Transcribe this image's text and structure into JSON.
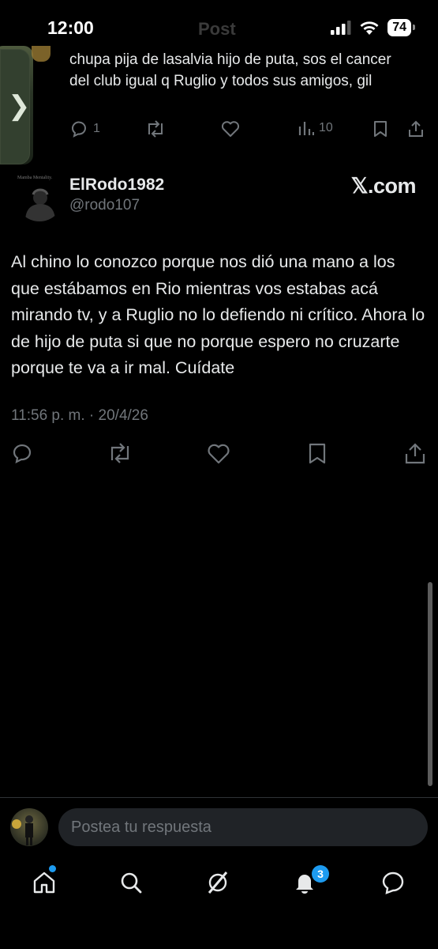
{
  "status_bar": {
    "time": "12:00",
    "battery": "74",
    "header_ghost": "Post"
  },
  "previous_tweet": {
    "text": "chupa pija de lasalvia hijo de puta, sos el cancer del club igual q Ruglio y todos sus amigos, gil",
    "replies": "1",
    "views": "10"
  },
  "tweet": {
    "display_name": "ElRodo1982",
    "handle": "@rodo107",
    "avatar_caption": "Mamba Mentality.",
    "body": "Al chino lo conozco porque nos dió una mano  a los que estábamos en Rio mientras vos estabas acá mirando tv, y a Ruglio no lo defiendo ni crítico. Ahora lo de hijo de puta si que no porque espero no cruzarte porque te va a ir mal. Cuídate",
    "timestamp": "11:56 p. m. · 20/4/26"
  },
  "source_label": "𝕏.com",
  "reply_bar": {
    "placeholder": "Postea tu respuesta"
  },
  "tab_bar": {
    "notifications_badge": "3"
  },
  "colors": {
    "accent": "#1d9bf0",
    "muted": "#71767b",
    "text": "#e7e9ea",
    "background": "#000000"
  }
}
